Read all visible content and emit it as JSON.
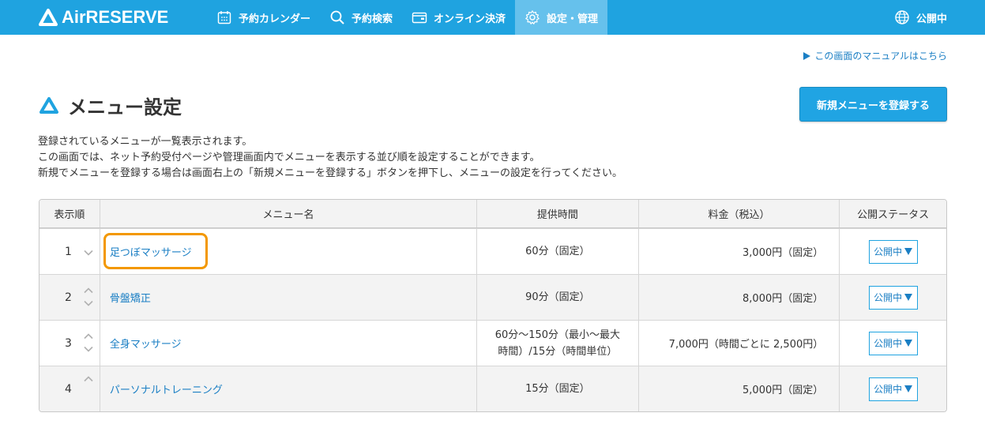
{
  "header": {
    "logo": "AirRESERVE",
    "nav": [
      {
        "label": "予約カレンダー",
        "icon": "calendar-icon"
      },
      {
        "label": "予約検索",
        "icon": "search-icon"
      },
      {
        "label": "オンライン決済",
        "icon": "wallet-icon"
      },
      {
        "label": "設定・管理",
        "icon": "gear-icon"
      }
    ],
    "status": "公開中",
    "status_icon": "globe-icon"
  },
  "manual_link": "この画面のマニュアルはこちら",
  "page": {
    "title": "メニュー設定",
    "register_button": "新規メニューを登録する",
    "description": [
      "登録されているメニューが一覧表示されます。",
      "この画面では、ネット予約受付ページや管理画面内でメニューを表示する並び順を設定することができます。",
      "新規でメニューを登録する場合は画面右上の「新規メニューを登録する」ボタンを押下し、メニューの設定を行ってください。"
    ]
  },
  "table": {
    "headers": [
      "表示順",
      "メニュー名",
      "提供時間",
      "料金（税込）",
      "公開ステータス"
    ],
    "rows": [
      {
        "order": "1",
        "name": "足つぼマッサージ",
        "time_line1": "60分（固定）",
        "time_line2": "",
        "price": "3,000円（固定）",
        "status": "公開中"
      },
      {
        "order": "2",
        "name": "骨盤矯正",
        "time_line1": "90分（固定）",
        "time_line2": "",
        "price": "8,000円（固定）",
        "status": "公開中"
      },
      {
        "order": "3",
        "name": "全身マッサージ",
        "time_line1": "60分〜150分（最小〜最大",
        "time_line2": "時間）/15分（時間単位）",
        "price": "7,000円（時間ごとに 2,500円）",
        "status": "公開中"
      },
      {
        "order": "4",
        "name": "パーソナルトレーニング",
        "time_line1": "15分（固定）",
        "time_line2": "",
        "price": "5,000円（固定）",
        "status": "公開中"
      }
    ]
  },
  "colors": {
    "header_bg": "#1fa3e0",
    "link": "#1b7fc4",
    "highlight": "#f39800"
  }
}
